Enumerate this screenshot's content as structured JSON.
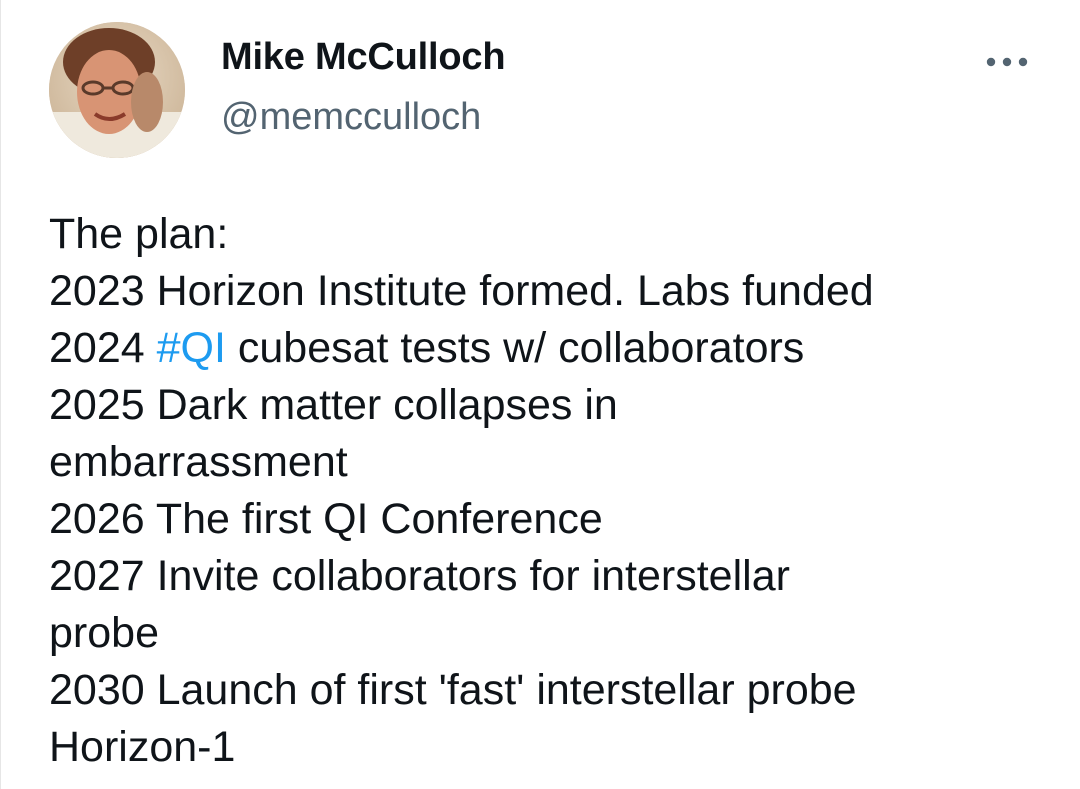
{
  "author": {
    "name": "Mike McCulloch",
    "handle": "@memcculloch",
    "avatar_icon": "profile-photo"
  },
  "more_icon": "more-options-icon",
  "colors": {
    "hashtag": "#1d9bf0",
    "text": "#0f1419",
    "handle": "#536471"
  },
  "tweet": {
    "line1": "The plan:",
    "line2": "2023 Horizon Institute formed. Labs funded",
    "line3_prefix": "2024 ",
    "line3_hashtag": "#QI",
    "line3_suffix": " cubesat tests w/ collaborators",
    "line4": "2025 Dark matter collapses in",
    "line5": "embarrassment",
    "line6": "2026 The first QI Conference",
    "line7": "2027 Invite collaborators for interstellar",
    "line8": "probe",
    "line9": "2030 Launch of first 'fast' interstellar probe",
    "line10": "Horizon-1"
  }
}
